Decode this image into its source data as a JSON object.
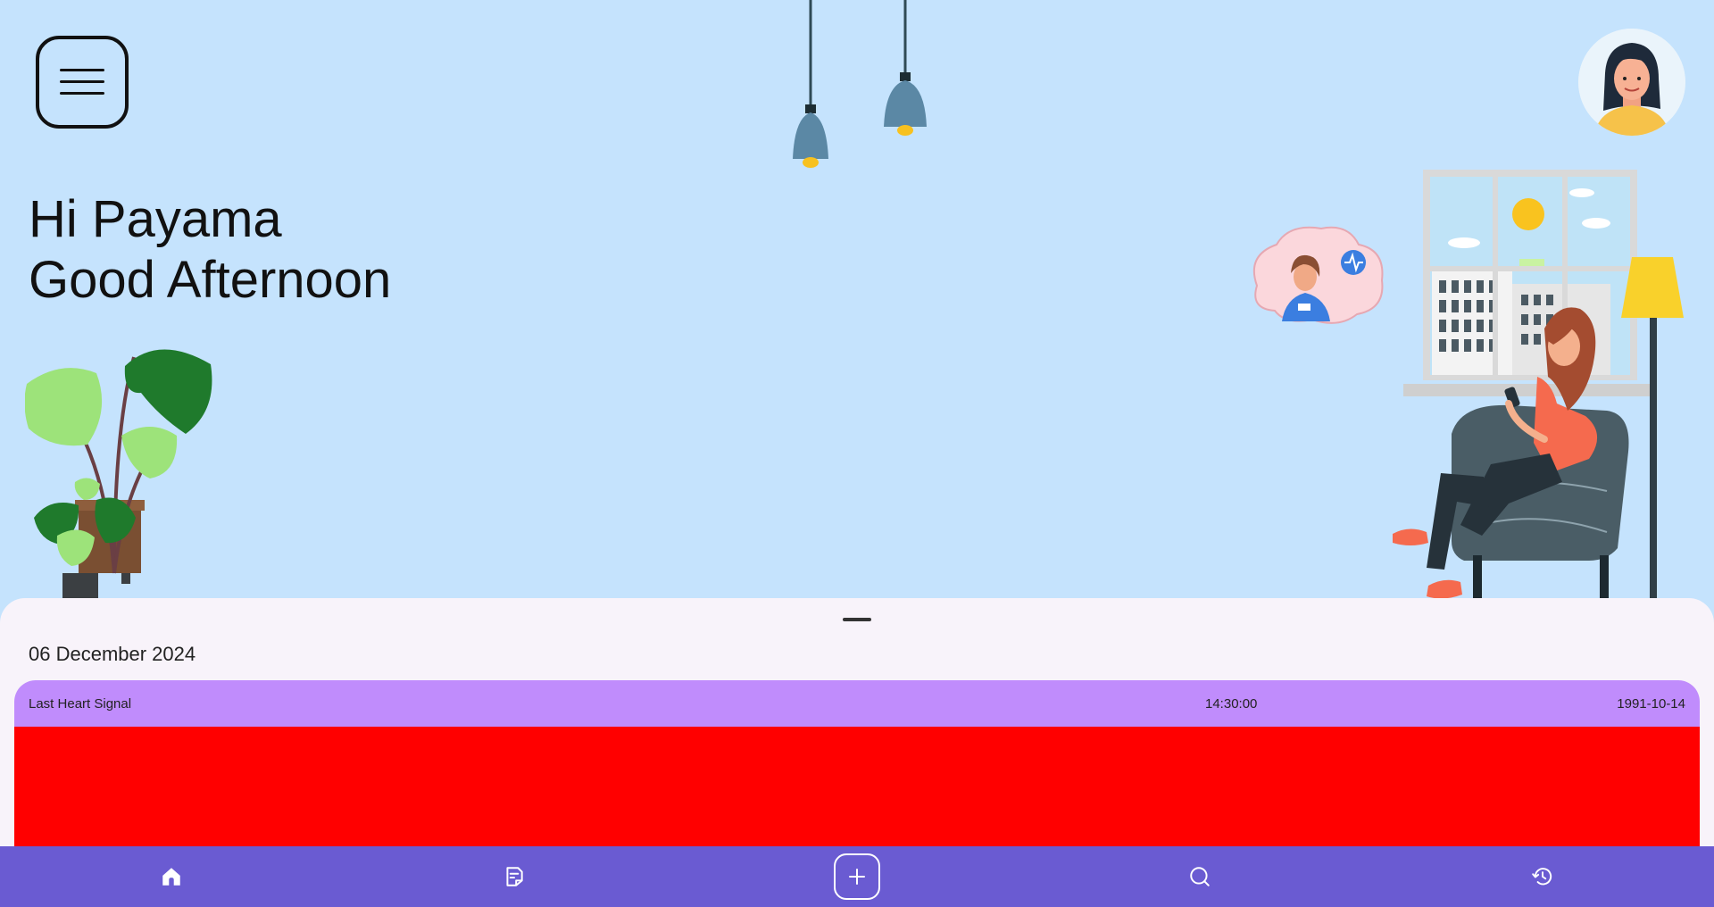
{
  "greeting": {
    "line1": "Hi Payama",
    "line2": "Good Afternoon"
  },
  "sheet": {
    "date": "06 December 2024",
    "card": {
      "title": "Last Heart Signal",
      "time": "14:30:00",
      "date": "1991-10-14"
    }
  },
  "nav": {
    "items": [
      {
        "icon": "home-icon"
      },
      {
        "icon": "document-icon"
      },
      {
        "icon": "add-icon"
      },
      {
        "icon": "search-icon"
      },
      {
        "icon": "history-icon"
      }
    ]
  },
  "colors": {
    "background": "#c5e3fd",
    "sheet": "#f8f3fa",
    "card_header": "#c08cfc",
    "card_body": "#ff0000",
    "nav": "#6a5bd2"
  }
}
